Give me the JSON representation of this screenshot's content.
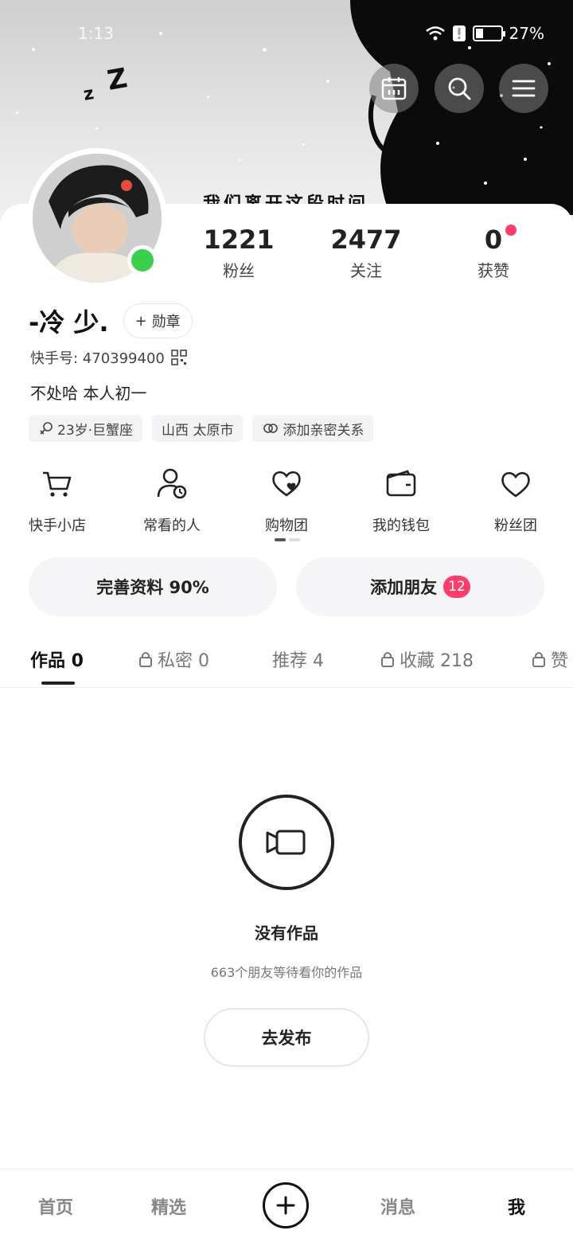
{
  "status_bar": {
    "time": "1:13",
    "battery": "27%"
  },
  "banner": {
    "quote": "我们离开这段时间"
  },
  "stats": [
    {
      "value": "1221",
      "label": "粉丝"
    },
    {
      "value": "2477",
      "label": "关注"
    },
    {
      "value": "0",
      "label": "获赞"
    }
  ],
  "profile": {
    "name": "-冷 少.",
    "badge_label": "勋章",
    "kuaishou_id": "快手号: 470399400",
    "bio": "不处哈 本人初一",
    "tags": [
      "23岁·巨蟹座",
      "山西 太原市",
      "添加亲密关系"
    ]
  },
  "shortcuts": [
    {
      "label": "快手小店",
      "icon": "cart-icon"
    },
    {
      "label": "常看的人",
      "icon": "person-clock-icon"
    },
    {
      "label": "购物团",
      "icon": "heart-group-icon"
    },
    {
      "label": "我的钱包",
      "icon": "wallet-icon"
    },
    {
      "label": "粉丝团",
      "icon": "heart-icon"
    }
  ],
  "actions": {
    "complete_profile": "完善资料 90%",
    "add_friend": "添加朋友",
    "add_friend_count": "12"
  },
  "tabs": [
    {
      "label": "作品 0",
      "locked": false
    },
    {
      "label": "私密 0",
      "locked": true
    },
    {
      "label": "推荐 4",
      "locked": false
    },
    {
      "label": "收藏 218",
      "locked": true
    },
    {
      "label": "赞",
      "locked": true
    }
  ],
  "empty_state": {
    "title": "没有作品",
    "subtitle": "663个朋友等待看你的作品",
    "button": "去发布"
  },
  "bottom_nav": [
    "首页",
    "精选",
    "消息",
    "我"
  ]
}
